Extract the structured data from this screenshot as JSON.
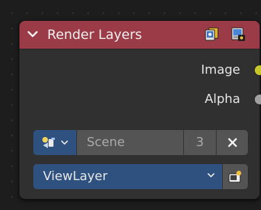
{
  "node": {
    "title": "Render Layers",
    "header_color": "#9b3b47",
    "header_icons": [
      "render-layers-icon",
      "render-result-icon"
    ]
  },
  "outputs": [
    {
      "label": "Image",
      "socket_color": "#c7c729"
    },
    {
      "label": "Alpha",
      "socket_color": "#a1a1a1"
    }
  ],
  "scene": {
    "name": "Scene",
    "users": "3",
    "picker_icon": "scene-icon",
    "clear_icon": "close-icon"
  },
  "view_layer": {
    "selected": "ViewLayer",
    "button_icon": "render-view-layer-icon"
  }
}
